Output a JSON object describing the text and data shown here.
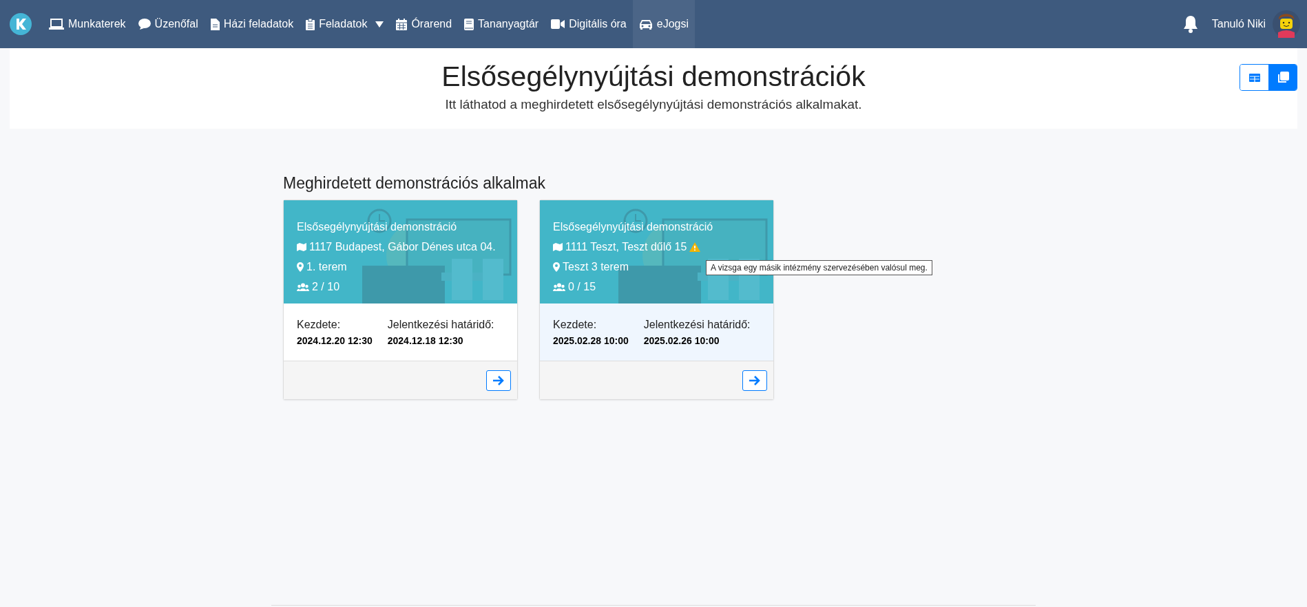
{
  "nav": {
    "items": [
      {
        "label": "Munkaterek",
        "kind": "laptop",
        "dropdown": false,
        "selected": false
      },
      {
        "label": "Üzenőfal",
        "kind": "comment",
        "dropdown": false,
        "selected": false
      },
      {
        "label": "Házi feladatok",
        "kind": "file",
        "dropdown": false,
        "selected": false
      },
      {
        "label": "Feladatok",
        "kind": "clipboard",
        "dropdown": true,
        "selected": false
      },
      {
        "label": "Órarend",
        "kind": "calendar",
        "dropdown": false,
        "selected": false
      },
      {
        "label": "Tananyagtár",
        "kind": "book",
        "dropdown": false,
        "selected": false
      },
      {
        "label": "Digitális óra",
        "kind": "video",
        "dropdown": false,
        "selected": false
      },
      {
        "label": "eJogsi",
        "kind": "car",
        "dropdown": false,
        "selected": true
      }
    ],
    "user": "Tanuló Niki"
  },
  "header": {
    "title": "Elsősegélynyújtási demonstrációk",
    "subtitle": "Itt láthatod a meghirdetett elsősegélynyújtási demonstrációs alkalmakat.",
    "view_toggle": [
      {
        "kind": "table",
        "selected": false
      },
      {
        "kind": "cards",
        "selected": true
      }
    ]
  },
  "section_title": "Meghirdetett demonstrációs alkalmak",
  "cards": [
    {
      "title": "Elsősegélynyújtási demonstráció",
      "address": "1117 Budapest, Gábor Dénes utca 04.",
      "room": "1. terem",
      "seats": "2 / 10",
      "external": false,
      "start_label": "Kezdete:",
      "start": "2024.12.20 12:30",
      "deadline_label": "Jelentkezési határidő:",
      "deadline": "2024.12.18 12:30"
    },
    {
      "title": "Elsősegélynyújtási demonstráció",
      "address": "1111 Teszt, Teszt dűlő 15",
      "room": "Teszt 3 terem",
      "seats": "0 / 15",
      "external": true,
      "tooltip": "A vizsga egy másik intézmény szervezésében valósul meg.",
      "start_label": "Kezdete:",
      "start": "2025.02.28 10:00",
      "deadline_label": "Jelentkezési határidő:",
      "deadline": "2025.02.26 10:00"
    }
  ]
}
